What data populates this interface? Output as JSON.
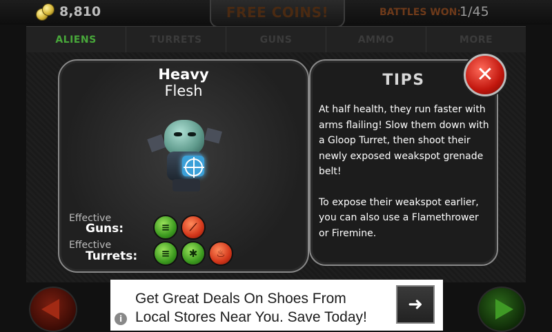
{
  "header": {
    "coin_count": "8,810",
    "free_coins_label": "FREE COINS!",
    "battles_won_label": "BATTLES WON:",
    "battles_won_value": "1/45"
  },
  "tabs": [
    {
      "label": "ALIENS",
      "active": true
    },
    {
      "label": "TURRETS",
      "active": false
    },
    {
      "label": "GUNS",
      "active": false
    },
    {
      "label": "AMMO",
      "active": false
    },
    {
      "label": "MORE",
      "active": false
    }
  ],
  "alien": {
    "name_line1": "Heavy",
    "name_line2": "Flesh",
    "effective_guns_small": "Effective",
    "effective_guns_big": "Guns:",
    "effective_turrets_small": "Effective",
    "effective_turrets_big": "Turrets:",
    "gun_icons": [
      "green-lines-icon",
      "red-flame-icon"
    ],
    "turret_icons": [
      "green-lines-icon",
      "green-splat-icon",
      "red-fire-icon"
    ]
  },
  "tips": {
    "title": "TIPS",
    "paragraph1": "At half health, they run faster with arms flailing! Slow them down with a Gloop Turret, then shoot their newly exposed weakspot grenade belt!",
    "paragraph2": "To expose their weakspot earlier, you can also use a Flamethrower or Firemine."
  },
  "close_label": "✕",
  "ad": {
    "text_line1": "Get Great Deals On Shoes From",
    "text_line2": "Local Stores Near You. Save Today!",
    "arrow": "➜",
    "info": "i"
  },
  "colors": {
    "active_tab": "#48a83a",
    "close_red": "#c2170e",
    "coin_gold": "#d6b73a"
  }
}
